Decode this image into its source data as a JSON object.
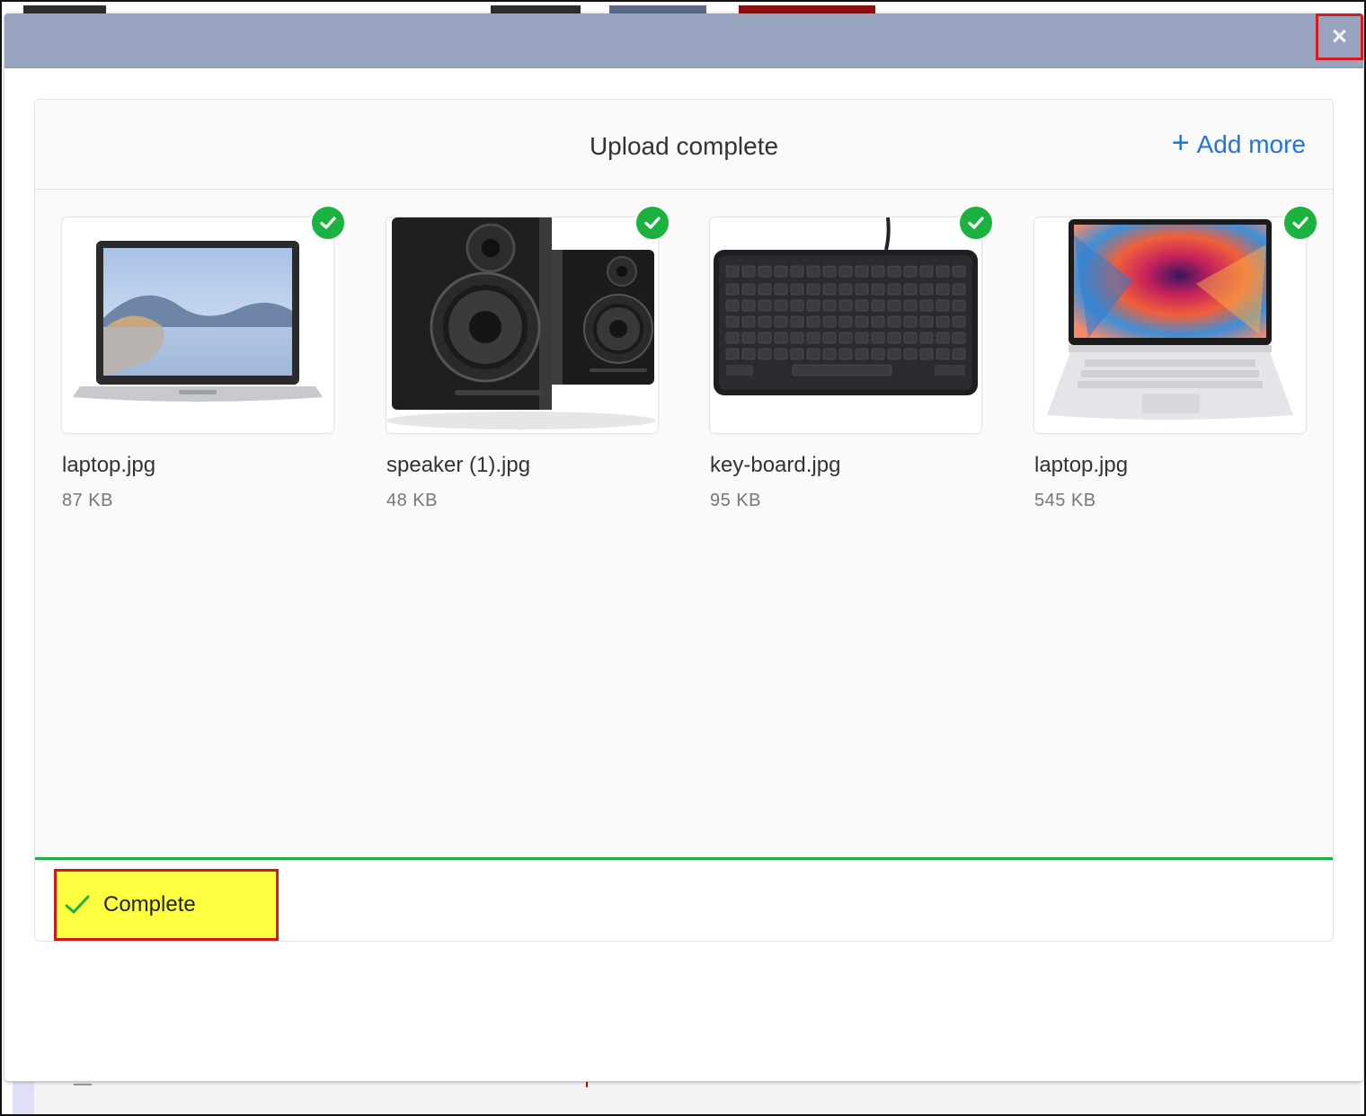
{
  "modal": {
    "close_label": "×"
  },
  "dashboard": {
    "title": "Upload complete",
    "add_more_icon": "+",
    "add_more_label": "Add more",
    "files": [
      {
        "name": "laptop.jpg",
        "size": "87 KB",
        "thumbnail": "laptop-silver"
      },
      {
        "name": "speaker (1).jpg",
        "size": "48 KB",
        "thumbnail": "speakers-black"
      },
      {
        "name": "key-board.jpg",
        "size": "95 KB",
        "thumbnail": "keyboard-black"
      },
      {
        "name": "laptop.jpg",
        "size": "545 KB",
        "thumbnail": "laptop-colorful"
      }
    ],
    "status": {
      "label": "Complete",
      "progress": 1.0
    }
  },
  "colors": {
    "header": "#98a3bf",
    "accent": "#2275d7",
    "success": "#1bb240",
    "highlight": "#ffff42",
    "annotation_border": "#cc1b1b"
  }
}
